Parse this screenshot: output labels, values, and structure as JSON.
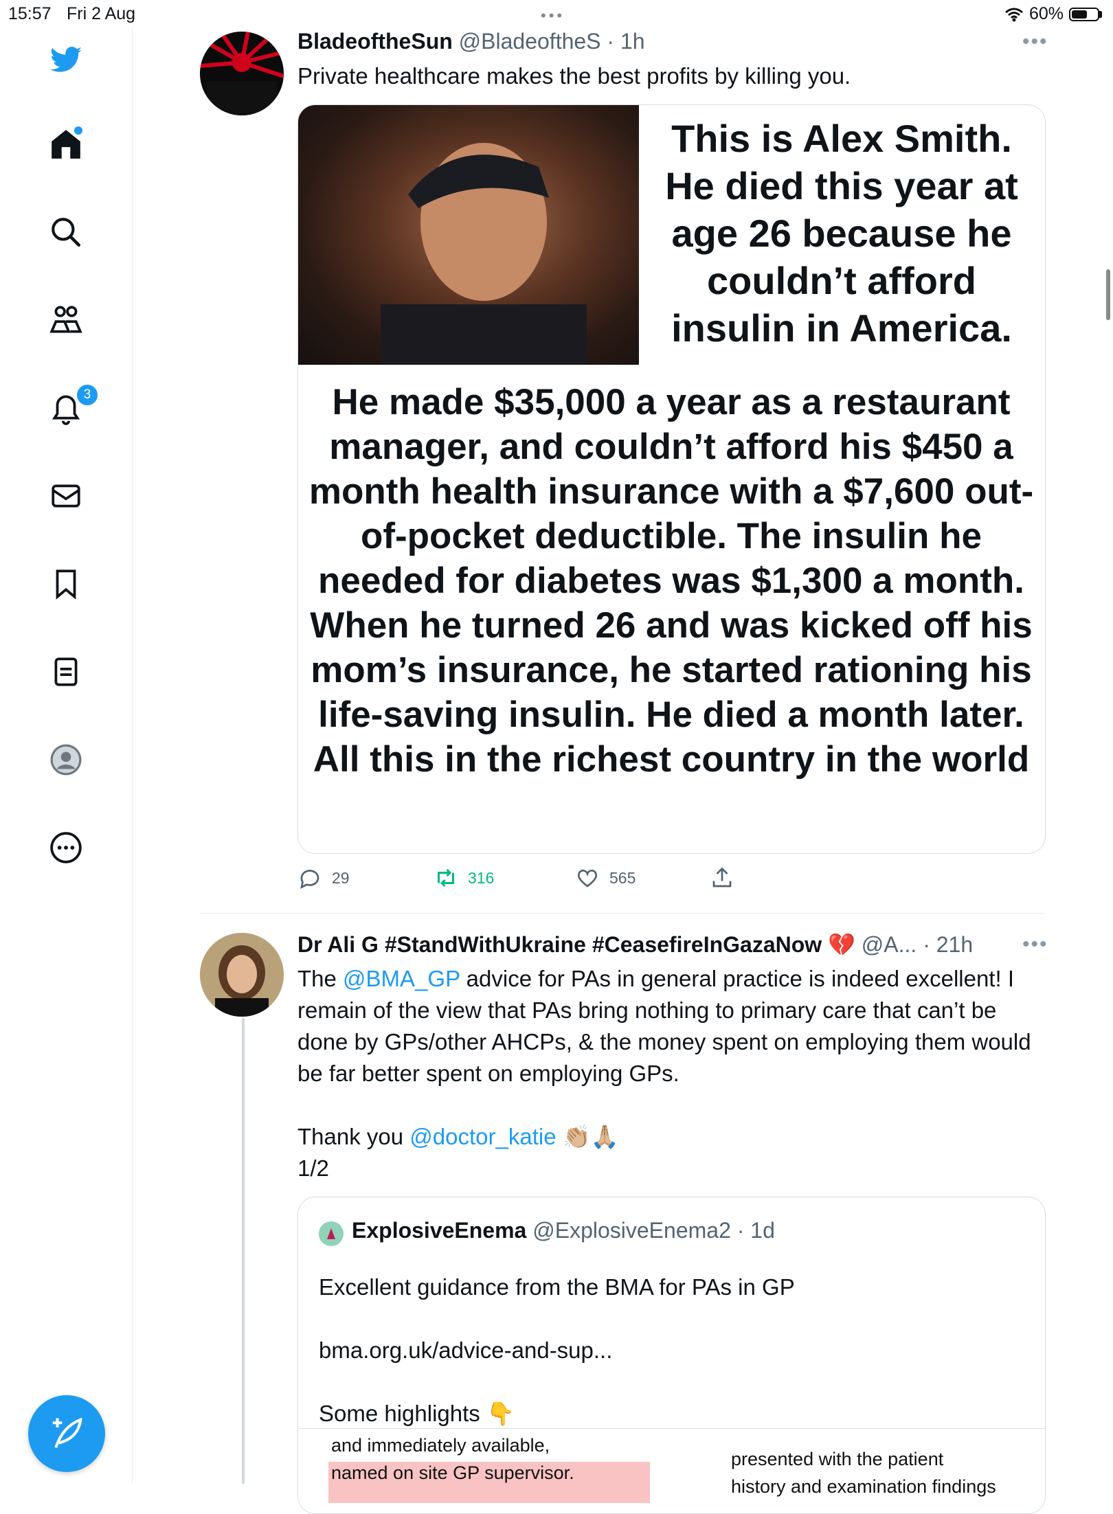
{
  "status": {
    "time": "15:57",
    "date": "Fri 2 Aug",
    "battery": "60%",
    "battery_level": 0.6
  },
  "sidebar": {
    "items": [
      {
        "name": "Twitter",
        "icon": "twitter-bird-icon"
      },
      {
        "name": "Home",
        "icon": "home-icon",
        "has_dot": true
      },
      {
        "name": "Explore",
        "icon": "search-icon"
      },
      {
        "name": "Communities",
        "icon": "communities-icon"
      },
      {
        "name": "Notifications",
        "icon": "bell-icon",
        "badge": "3"
      },
      {
        "name": "Messages",
        "icon": "mail-icon"
      },
      {
        "name": "Bookmarks",
        "icon": "bookmark-icon"
      },
      {
        "name": "Lists",
        "icon": "list-icon"
      },
      {
        "name": "Profile",
        "icon": "profile-icon"
      },
      {
        "name": "More",
        "icon": "more-circle-icon"
      }
    ],
    "compose_icon": "compose-feather-icon"
  },
  "tweet1": {
    "name": "BladeoftheSun",
    "handle": "@BladeoftheS",
    "time": "· 1h",
    "text": "Private healthcare makes the best profits by killing you.",
    "image_headline": "This is Alex Smith. He died this year at age 26 because he couldn’t afford insulin in America.",
    "image_body": "He made $35,000 a year as a restaurant manager, and couldn’t afford his $450 a month health insurance with a $7,600 out-of-pocket deductible. The insulin he needed for diabetes was $1,300 a month. When he turned 26 and was kicked off his mom’s insurance, he started rationing his life-saving insulin. He died a month later. All this in the richest country in the world",
    "replies": "29",
    "retweets": "316",
    "likes": "565"
  },
  "tweet2": {
    "name": "Dr Ali G #StandWithUkraine #CeasefireInGazaNow 💔",
    "handle": "@A...",
    "time": "· 21h",
    "text_pre": "The ",
    "mention1": "@BMA_GP",
    "text_mid": " advice for PAs in general practice is indeed excellent! I remain of the view that PAs bring nothing to primary care that can’t be done by GPs/other AHCPs, & the money spent on employing them would be far better spent on employing GPs.",
    "thanks_pre": "Thank you ",
    "mention2": "@doctor_katie",
    "thanks_emoji": "👏🏼🙏🏼",
    "counter": "1/2"
  },
  "quote": {
    "name": "ExplosiveEnema",
    "handle": "@ExplosiveEnema2",
    "time": "· 1d",
    "line1": "Excellent guidance from the BMA for PAs in GP",
    "line2": "bma.org.uk/advice-and-sup...",
    "line3": "Some highlights 👇",
    "image_left": [
      "and immediately available,",
      "named on site GP supervisor."
    ],
    "image_right": [
      "presented with the patient",
      "history and examination findings"
    ]
  },
  "colors": {
    "accent": "#1d9bf0",
    "retweet": "#00ba7c",
    "divider": "#e6ecf0"
  }
}
